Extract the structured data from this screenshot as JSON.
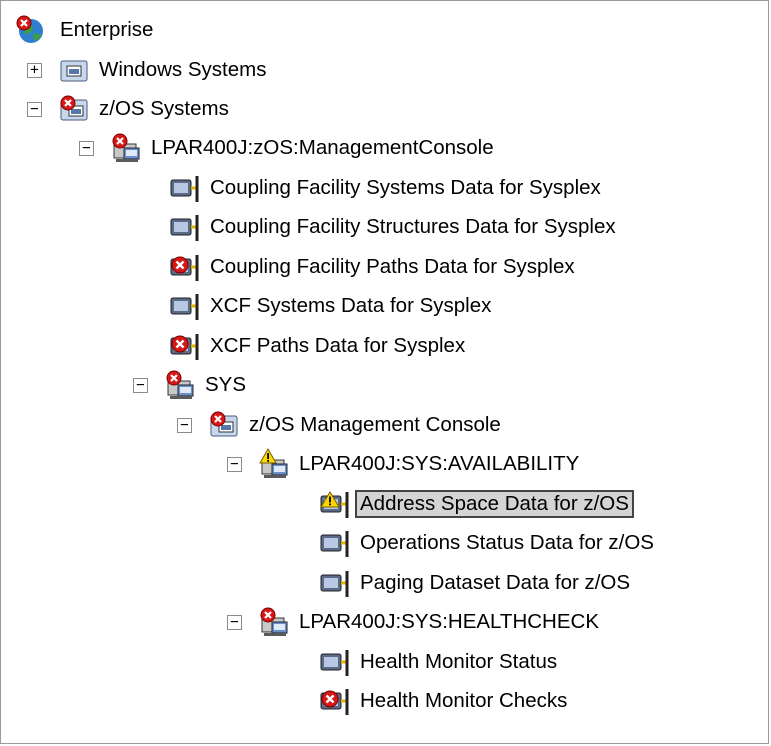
{
  "colors": {
    "selection": "#d4d4d4",
    "alert": "#d81818",
    "warning": "#ffd700"
  },
  "tree": {
    "n0": {
      "label": "Enterprise",
      "icon": "globe-icon",
      "status": "critical"
    },
    "n1": {
      "label": "Windows Systems",
      "icon": "folder-icon",
      "status": "ok",
      "toggle": "+"
    },
    "n2": {
      "label": "z/OS Systems",
      "icon": "folder-icon",
      "status": "critical",
      "toggle": "−"
    },
    "n3": {
      "label": "LPAR400J:zOS:ManagementConsole",
      "icon": "managed-system-icon",
      "status": "critical",
      "toggle": "−"
    },
    "n4": {
      "label": "Coupling Facility Systems Data for Sysplex",
      "icon": "workspace-icon",
      "status": "ok"
    },
    "n5": {
      "label": "Coupling Facility Structures Data for Sysplex",
      "icon": "workspace-icon",
      "status": "ok"
    },
    "n6": {
      "label": "Coupling Facility Paths Data for Sysplex",
      "icon": "workspace-icon",
      "status": "critical"
    },
    "n7": {
      "label": "XCF Systems Data for Sysplex",
      "icon": "workspace-icon",
      "status": "ok"
    },
    "n8": {
      "label": "XCF Paths Data for Sysplex",
      "icon": "workspace-icon",
      "status": "critical"
    },
    "n9": {
      "label": "SYS",
      "icon": "managed-system-icon",
      "status": "critical",
      "toggle": "−"
    },
    "n10": {
      "label": "z/OS Management Console",
      "icon": "folder-icon",
      "status": "critical",
      "toggle": "−"
    },
    "n11": {
      "label": "LPAR400J:SYS:AVAILABILITY",
      "icon": "managed-system-icon",
      "status": "warning",
      "toggle": "−"
    },
    "n12": {
      "label": "Address Space Data for z/OS",
      "icon": "workspace-icon",
      "status": "warning",
      "selected": true
    },
    "n13": {
      "label": "Operations Status Data for z/OS",
      "icon": "workspace-icon",
      "status": "ok"
    },
    "n14": {
      "label": "Paging Dataset Data for z/OS",
      "icon": "workspace-icon",
      "status": "ok"
    },
    "n15": {
      "label": "LPAR400J:SYS:HEALTHCHECK",
      "icon": "managed-system-icon",
      "status": "critical",
      "toggle": "−"
    },
    "n16": {
      "label": "Health Monitor Status",
      "icon": "workspace-icon",
      "status": "ok"
    },
    "n17": {
      "label": "Health Monitor Checks",
      "icon": "workspace-icon",
      "status": "critical"
    }
  }
}
